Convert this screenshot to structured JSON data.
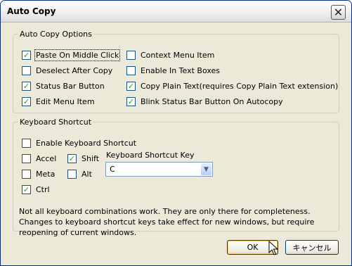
{
  "window": {
    "title": "Auto Copy",
    "close_label": "✕"
  },
  "options": {
    "legend": "Auto Copy Options",
    "items": [
      {
        "label": "Paste On Middle Click",
        "checked": true
      },
      {
        "label": "Deselect After Copy",
        "checked": false
      },
      {
        "label": "Status Bar Button",
        "checked": true
      },
      {
        "label": "Edit Menu Item",
        "checked": true
      },
      {
        "label": "Context Menu Item",
        "checked": false
      },
      {
        "label": "Enable In Text Boxes",
        "checked": false
      },
      {
        "label": "Copy Plain Text(requires Copy Plain Text extension)",
        "checked": true
      },
      {
        "label": "Blink Status Bar Button On Autocopy",
        "checked": true
      }
    ]
  },
  "shortcut": {
    "legend": "Keyboard Shortcut",
    "enable": {
      "label": "Enable Keyboard Shortcut",
      "checked": false
    },
    "accel": {
      "label": "Accel",
      "checked": false
    },
    "shift": {
      "label": "Shift",
      "checked": true
    },
    "meta": {
      "label": "Meta",
      "checked": false
    },
    "alt": {
      "label": "Alt",
      "checked": false
    },
    "ctrl": {
      "label": "Ctrl",
      "checked": true
    },
    "key_label": "Keyboard Shortcut Key",
    "key_value": "C",
    "note_line1": "Not all keyboard combinations work. They are only there for completeness.",
    "note_line2": "Changes to keyboard shortcut keys take effect for new windows, but require",
    "note_line3": "reopening of current windows."
  },
  "buttons": {
    "ok": "OK",
    "cancel": "キャンセル"
  }
}
